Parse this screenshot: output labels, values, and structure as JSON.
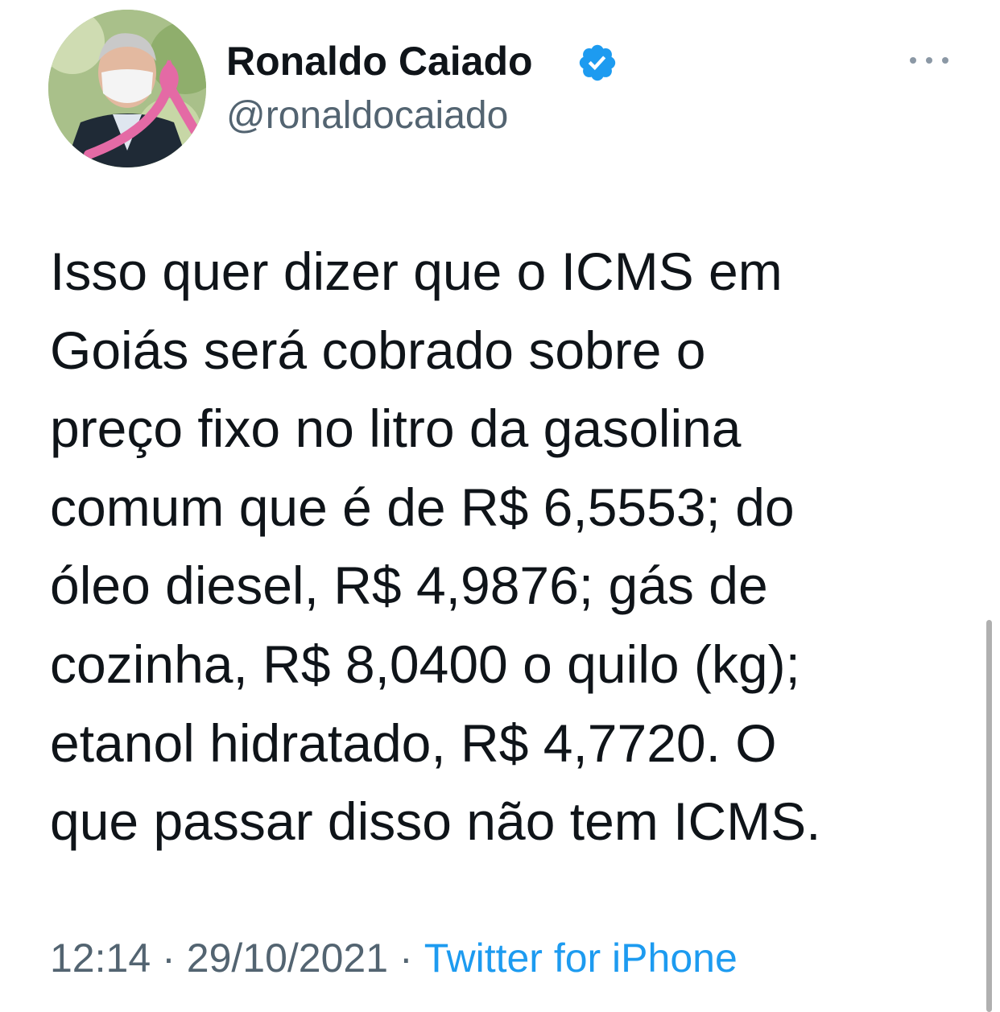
{
  "author": {
    "display_name": "Ronaldo Caiado",
    "handle": "@ronaldocaiado",
    "verified": true,
    "avatar_icon": "profile-photo-with-pink-ribbon"
  },
  "more_icon": "ellipsis-icon",
  "tweet": {
    "lines": [
      "Isso quer dizer que o ICMS em",
      "Goiás será cobrado sobre o",
      "preço fixo no litro da gasolina",
      "comum que é de R$ 6,5553; do",
      "óleo diesel, R$ 4,9876; gás de",
      "cozinha, R$ 8,0400 o quilo (kg);",
      "etanol hidratado, R$ 4,7720. O",
      "que passar disso não tem ICMS."
    ]
  },
  "meta": {
    "time": "12:14",
    "separator": "·",
    "date": "29/10/2021",
    "source": "Twitter for iPhone"
  },
  "colors": {
    "text": "#0f1419",
    "secondary": "#536471",
    "link": "#1d9bf0",
    "verified": "#1d9bf0",
    "ribbon": "#e46aa5"
  }
}
